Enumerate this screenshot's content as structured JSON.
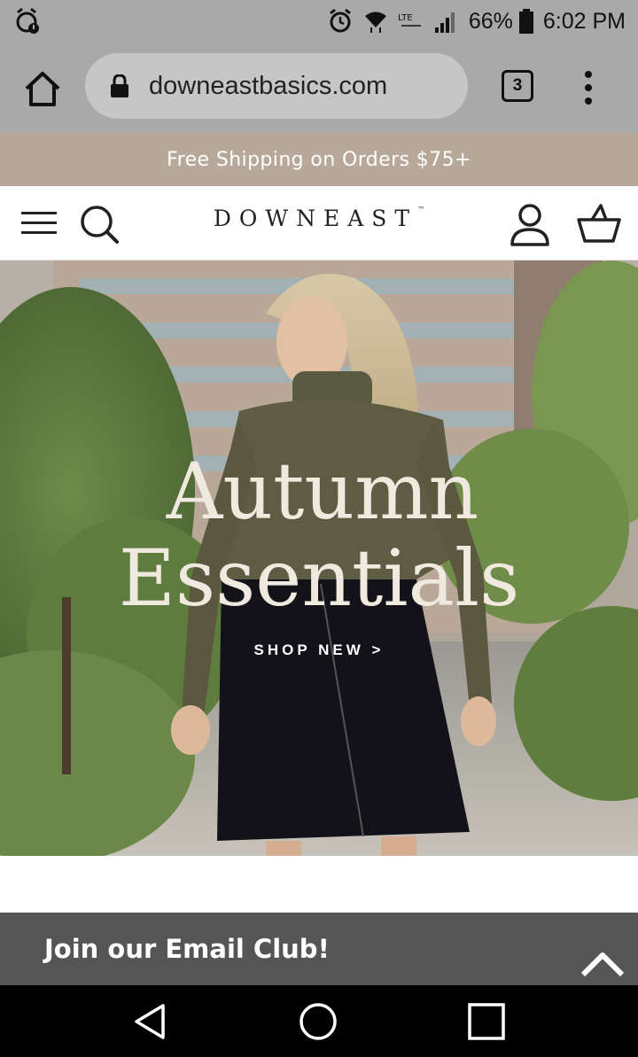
{
  "status_bar": {
    "left_icon": "alarm-clock-icon",
    "icons": [
      "alarm-icon",
      "wifi-icon",
      "lte-icon",
      "signal-icon"
    ],
    "battery_percent": "66%",
    "time": "6:02 PM"
  },
  "browser": {
    "url": "downeastbasics.com",
    "tab_count": "3",
    "icons": [
      "home-icon",
      "lock-icon",
      "more-vert-icon"
    ]
  },
  "promo": {
    "shipping_text": "Free Shipping on Orders $75+",
    "background_color": "#b8a89a"
  },
  "header": {
    "logo_text": "DOWNEAST",
    "logo_mark": "™",
    "icons": [
      "hamburger-menu-icon",
      "search-icon",
      "account-icon",
      "cart-icon"
    ]
  },
  "hero": {
    "title_line1": "Autumn",
    "title_line2": "Essentials",
    "cta_label": "SHOP NEW >"
  },
  "email_club": {
    "label": "Join our Email Club!",
    "icon": "chevron-up-icon",
    "background_color": "#555555"
  },
  "nav_bar": {
    "icons": [
      "back-icon",
      "home-circle-icon",
      "recent-apps-icon"
    ]
  }
}
